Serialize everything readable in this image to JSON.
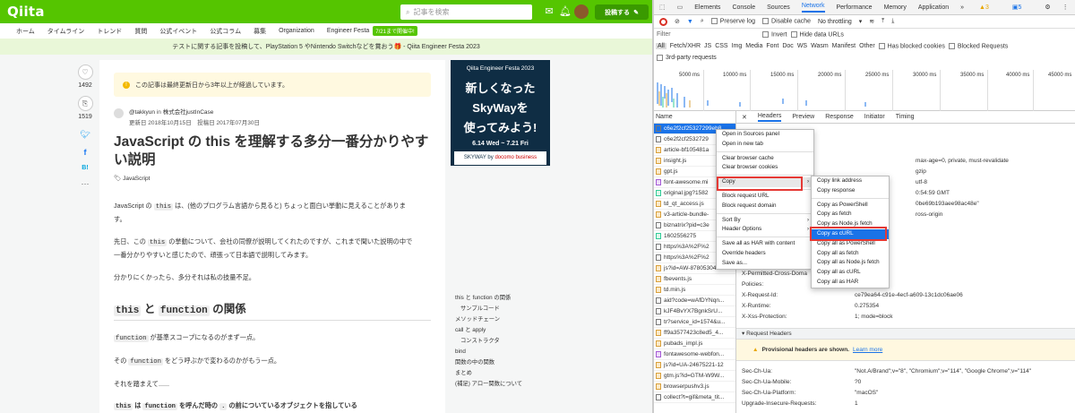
{
  "qiita": {
    "logo": "Qiita",
    "search_placeholder": "記事を検索",
    "post_button": "投稿する",
    "nav": [
      "ホーム",
      "タイムライン",
      "トレンド",
      "質問",
      "公式イベント",
      "公式コラム",
      "募集",
      "Organization",
      "Engineer Festa"
    ],
    "nav_badge": "7/21まで開催中!",
    "banner": "テストに関する記事を投稿して、PlayStation 5 やNintendo Switchなどを賞おう🎁 - Qiita Engineer Festa 2023",
    "like_count": "1492",
    "stock_count": "1519",
    "notice": "この記事は最終更新日から3年以上が経過しています。",
    "author": "@takkyun",
    "org_prefix": "in",
    "org": "株式会社justInCase",
    "dates": "更新日 2018年10月15日　投稿日 2017年07月30日",
    "title": "JavaScript の this を理解する多分一番分かりやすい説明",
    "tag": "JavaScript",
    "p1_a": "JavaScript の",
    "p1_code": "this",
    "p1_b": "は、(他のプログラム言語から見ると) ちょっと面白い挙動に見えることがありま",
    "p1_c": "す。",
    "p2_a": "先日、この",
    "p2_code": "this",
    "p2_b": "の挙動について、会社の同僚が説明してくれたのですが、これまで聞いた説明の中で",
    "p2_c": "一番分かりやすいと感じたので、頑張って日本語で説明してみます。",
    "p3": "分かりにくかったら、多分それは私の技量不足。",
    "h2_code1": "this",
    "h2_and": "と",
    "h2_code2": "function",
    "h2_rest": "の関係",
    "p4_code": "function",
    "p4_b": "が基準スコープになるのがまず一点。",
    "p5_a": "その",
    "p5_code": "function",
    "p5_b": "をどう呼ぶかで変わるのかがもう一点。",
    "p6": "それを踏まえて......",
    "p7_code1": "this",
    "p7_a": "は",
    "p7_code2": "function",
    "p7_b": "を呼んだ時の",
    "p7_code3": ".",
    "p7_c": "の前についているオブジェクトを指している",
    "ad": {
      "event": "Qiita Engineer Festa 2023",
      "line1": "新しくなった",
      "line2": "SkyWayを",
      "line3": "使ってみよう!",
      "date": "6.14 Wed ~ 7.21 Fri",
      "brand": "SKYWAY",
      "by": "by",
      "docomo": "docomo business"
    },
    "toc": [
      {
        "label": "this と function の関係",
        "indent": false
      },
      {
        "label": "サンプルコード",
        "indent": true
      },
      {
        "label": "メソッドチェーン",
        "indent": false
      },
      {
        "label": "call と apply",
        "indent": false
      },
      {
        "label": "コンストラクタ",
        "indent": true
      },
      {
        "label": "bind",
        "indent": false
      },
      {
        "label": "関数の中の関数",
        "indent": false
      },
      {
        "label": "まとめ",
        "indent": false
      },
      {
        "label": "(補足) アロー関数について",
        "indent": false
      }
    ]
  },
  "devtools": {
    "tabs": [
      "Elements",
      "Console",
      "Sources",
      "Network",
      "Performance",
      "Memory",
      "Application",
      "»"
    ],
    "active_tab": "Network",
    "warn_count": "3",
    "info_count": "5",
    "preserve_log": "Preserve log",
    "disable_cache": "Disable cache",
    "throttle": "No throttling",
    "filter_label": "Filter",
    "invert": "Invert",
    "hide_data": "Hide data URLs",
    "types": [
      "All",
      "Fetch/XHR",
      "JS",
      "CSS",
      "Img",
      "Media",
      "Font",
      "Doc",
      "WS",
      "Wasm",
      "Manifest",
      "Other"
    ],
    "blocked_cookies": "Has blocked cookies",
    "blocked_requests": "Blocked Requests",
    "third_party": "3rd-party requests",
    "ticks": [
      "5000 ms",
      "10000 ms",
      "15000 ms",
      "20000 ms",
      "25000 ms",
      "30000 ms",
      "35000 ms",
      "40000 ms",
      "45000 ms"
    ],
    "name_header": "Name",
    "requests": [
      {
        "name": "c6e2f2cf25327299eb8",
        "type": "doc",
        "sel": true
      },
      {
        "name": "c6e2f2cf2532729",
        "type": "doc"
      },
      {
        "name": "article-bf105481a",
        "type": "js"
      },
      {
        "name": "insight.js",
        "type": "js"
      },
      {
        "name": "gpt.js",
        "type": "js"
      },
      {
        "name": "font-awesome.mi",
        "type": "css"
      },
      {
        "name": "original.jpg?1582",
        "type": "img"
      },
      {
        "name": "td_qt_access.js",
        "type": "js"
      },
      {
        "name": "v3-article-bundle-",
        "type": "js"
      },
      {
        "name": "biznatrix?pid=c3e",
        "type": "doc"
      },
      {
        "name": "1602556275",
        "type": "img"
      },
      {
        "name": "https%3A%2F%2",
        "type": "doc"
      },
      {
        "name": "https%3A%2F%2",
        "type": "doc"
      },
      {
        "name": "js?id=AW-878053044",
        "type": "js"
      },
      {
        "name": "fbevents.js",
        "type": "js"
      },
      {
        "name": "td.min.js",
        "type": "js"
      },
      {
        "name": "aid?code=wAfDYNqn...",
        "type": "doc"
      },
      {
        "name": "kJF4BvYX7BgnkSrU...",
        "type": "doc"
      },
      {
        "name": "tr?service_id=1574&u...",
        "type": "doc"
      },
      {
        "name": "ff9a3577423c8ed5_4...",
        "type": "js"
      },
      {
        "name": "pubads_impl.js",
        "type": "js"
      },
      {
        "name": "fontawesome-webfon...",
        "type": "css"
      },
      {
        "name": "js?id=UA-24675221-12",
        "type": "js"
      },
      {
        "name": "gtm.js?id=GTM-W9W...",
        "type": "js"
      },
      {
        "name": "browserpushv3.js",
        "type": "js"
      },
      {
        "name": "collect?t=gif&meta_tit...",
        "type": "doc"
      }
    ],
    "detail_tabs": [
      "Headers",
      "Preview",
      "Response",
      "Initiator",
      "Timing"
    ],
    "right_values": [
      "max-age=0, private, must-revalidate",
      "gzip",
      "utf-8",
      "0:54:59 GMT",
      "0be69b193aee98ac48e\"",
      "ross-origin"
    ],
    "headers": [
      {
        "k": "X-Permitted-Cross-Doma",
        "v": ""
      },
      {
        "k": "Policies:",
        "v": ""
      },
      {
        "k": "X-Request-Id:",
        "v": "ce79ea64-c91e-4ecf-a609-13c1dc06ae06"
      },
      {
        "k": "X-Runtime:",
        "v": "0.275354"
      },
      {
        "k": "X-Xss-Protection:",
        "v": "1; mode=block"
      }
    ],
    "request_headers_title": "▾ Request Headers",
    "provisional": "Provisional headers are shown.",
    "learn_more": "Learn more",
    "req_headers": [
      {
        "k": "Sec-Ch-Ua:",
        "v": "\"Not.A/Brand\";v=\"8\", \"Chromium\";v=\"114\", \"Google Chrome\";v=\"114\""
      },
      {
        "k": "Sec-Ch-Ua-Mobile:",
        "v": "?0"
      },
      {
        "k": "Sec-Ch-Ua-Platform:",
        "v": "\"macOS\""
      },
      {
        "k": "Upgrade-Insecure-Requests:",
        "v": "1"
      }
    ],
    "context_menu": [
      "Open in Sources panel",
      "Open in new tab",
      "Clear browser cache",
      "Clear browser cookies",
      "Copy",
      "Block request URL",
      "Block request domain",
      "Sort By",
      "Header Options",
      "Save all as HAR with content",
      "Override headers",
      "Save as..."
    ],
    "copy_submenu": [
      "Copy link address",
      "Copy response",
      "Copy as PowerShell",
      "Copy as fetch",
      "Copy as Node.js fetch",
      "Copy as cURL",
      "Copy all as PowerShell",
      "Copy all as fetch",
      "Copy all as Node.js fetch",
      "Copy all as cURL",
      "Copy all as HAR"
    ]
  }
}
